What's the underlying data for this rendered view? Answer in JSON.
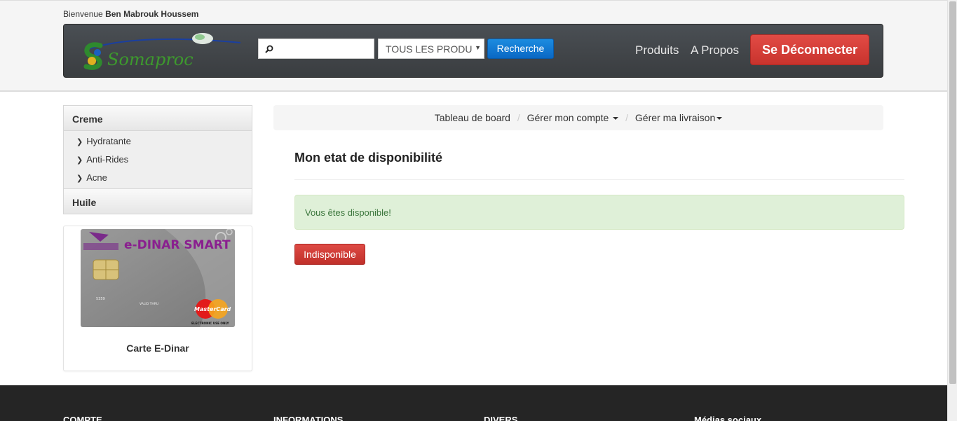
{
  "header": {
    "welcome_prefix": "Bienvenue",
    "user_name": "Ben Mabrouk Houssem",
    "logo_text": "Somaproc",
    "search": {
      "placeholder": "",
      "value": ""
    },
    "category_select": {
      "selected": "TOUS LES PRODU"
    },
    "search_button": "Recherche",
    "nav": {
      "produits": "Produits",
      "apropos": "A Propos"
    },
    "logout_button": "Se Déconnecter"
  },
  "sidebar": {
    "categories": [
      {
        "label": "Creme",
        "items": [
          "Hydratante",
          "Anti-Rides",
          "Acne"
        ]
      },
      {
        "label": "Huile",
        "items": []
      }
    ],
    "card": {
      "brand": "e-DINAR SMART",
      "network": "MasterCard",
      "card_number_hint": "5359",
      "valid_thru": "VALID THRU",
      "electronic": "ELECTRONIC USE ONLY",
      "caption": "Carte E-Dinar"
    }
  },
  "breadcrumb": {
    "dashboard": "Tableau de board",
    "account": "Gérer mon compte",
    "delivery": "Gérer ma livraison"
  },
  "main": {
    "title": "Mon etat de disponibilité",
    "alert": "Vous êtes disponible!",
    "unavailable_button": "Indisponible"
  },
  "footer": {
    "col1": "COMPTE",
    "col2": "INFORMATIONS",
    "col3": "DIVERS",
    "col4": "Médias sociaux"
  },
  "colors": {
    "navbar": "#3f4347",
    "primary": "#0a68c4",
    "danger": "#c8332d",
    "success_bg": "#dff0d8",
    "success_text": "#3c763d",
    "footer": "#252525"
  }
}
